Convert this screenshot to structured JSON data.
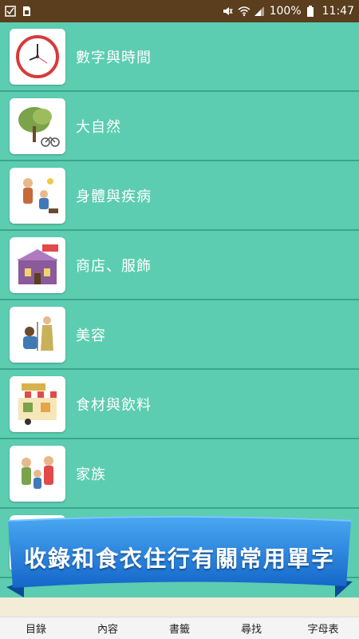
{
  "status": {
    "battery": "100%",
    "time": "11:47"
  },
  "categories": [
    {
      "label": "數字與時間",
      "icon": "clock-icon"
    },
    {
      "label": "大自然",
      "icon": "tree-icon"
    },
    {
      "label": "身體與疾病",
      "icon": "family-sick-icon"
    },
    {
      "label": "商店、服飾",
      "icon": "shop-icon"
    },
    {
      "label": "美容",
      "icon": "hair-salon-icon"
    },
    {
      "label": "食材與飲料",
      "icon": "food-store-icon"
    },
    {
      "label": "家族",
      "icon": "family-icon"
    },
    {
      "label": "",
      "icon": "partial-icon"
    }
  ],
  "banner": {
    "text": "收錄和食衣住行有關常用單字"
  },
  "nav": [
    {
      "label": "目錄"
    },
    {
      "label": "內容"
    },
    {
      "label": "書籤"
    },
    {
      "label": "尋找"
    },
    {
      "label": "字母表"
    }
  ],
  "colors": {
    "list_bg": "#5ccdb0",
    "status_bg": "#5a3e1d",
    "banner_blue": "#1f7fe0"
  }
}
